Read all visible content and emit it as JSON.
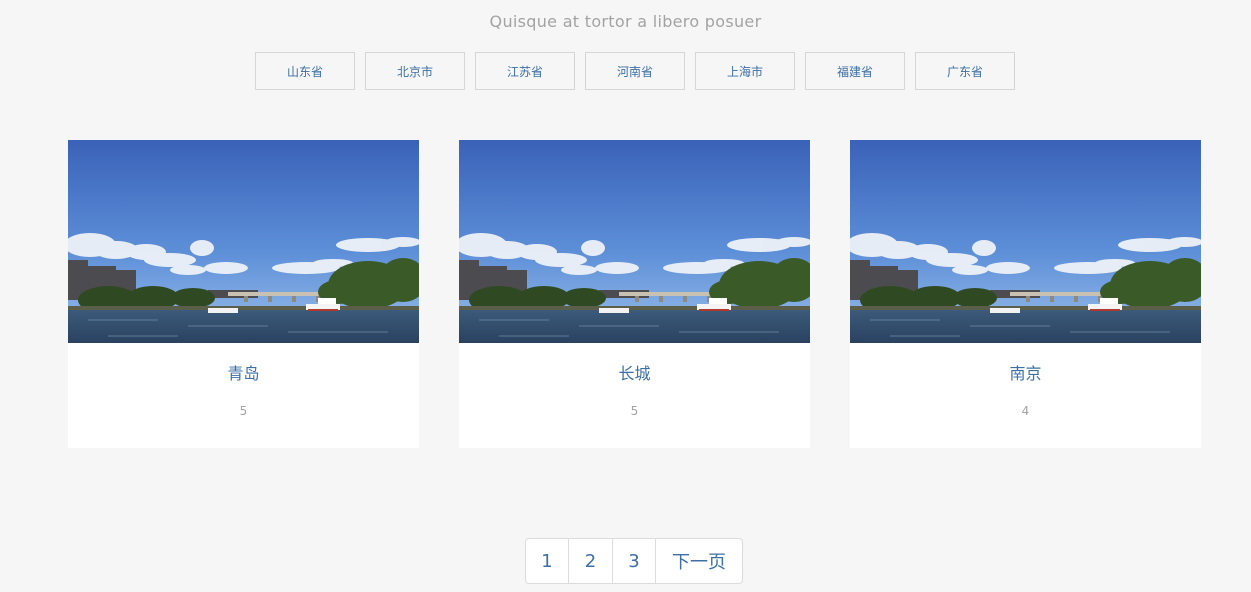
{
  "subtitle": "Quisque at tortor a libero posuer",
  "filters": [
    "山东省",
    "北京市",
    "江苏省",
    "河南省",
    "上海市",
    "福建省",
    "广东省"
  ],
  "cards": [
    {
      "title": "青岛",
      "count": "5",
      "image": "river-city-photo"
    },
    {
      "title": "长城",
      "count": "5",
      "image": "river-city-photo"
    },
    {
      "title": "南京",
      "count": "4",
      "image": "river-city-photo"
    }
  ],
  "pagination": {
    "pages": [
      "1",
      "2",
      "3"
    ],
    "next_label": "下一页"
  },
  "colors": {
    "background": "#f6f6f6",
    "link": "#3c6fa5",
    "muted": "#a3a3a3",
    "border": "#d6d6d6",
    "card": "#ffffff"
  }
}
